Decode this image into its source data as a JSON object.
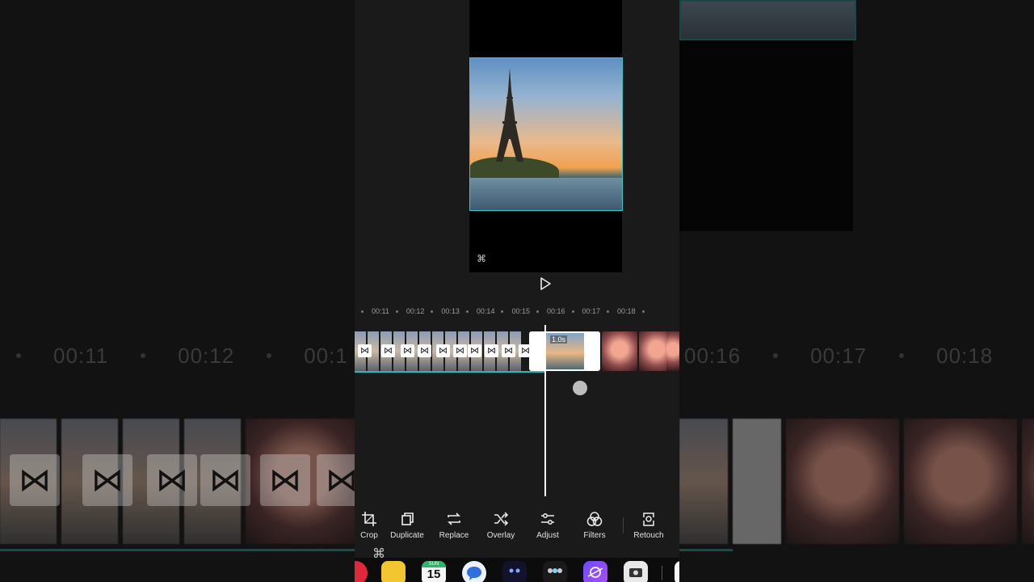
{
  "editor": {
    "timeline_labels": [
      "00:11",
      "00:12",
      "00:13",
      "00:14",
      "00:15",
      "00:16",
      "00:17",
      "00:18"
    ],
    "selected_clip_duration": "1.0s"
  },
  "background": {
    "ruler_labels": [
      "00:11",
      "00:12",
      "00:1",
      "00:16",
      "00:17",
      "00:18"
    ]
  },
  "toolbar": {
    "items": [
      {
        "label": "Crop",
        "icon": "crop-icon"
      },
      {
        "label": "Duplicate",
        "icon": "duplicate-icon"
      },
      {
        "label": "Replace",
        "icon": "replace-icon"
      },
      {
        "label": "Overlay",
        "icon": "overlay-icon"
      },
      {
        "label": "Adjust",
        "icon": "adjust-icon"
      },
      {
        "label": "Filters",
        "icon": "filters-icon"
      },
      {
        "label": "Retouch",
        "icon": "retouch-icon"
      }
    ]
  },
  "dock": {
    "calendar_day": "15",
    "calendar_weekday": "SUN"
  },
  "colors": {
    "accent": "#37c8c8",
    "background": "#1a1a1a"
  }
}
